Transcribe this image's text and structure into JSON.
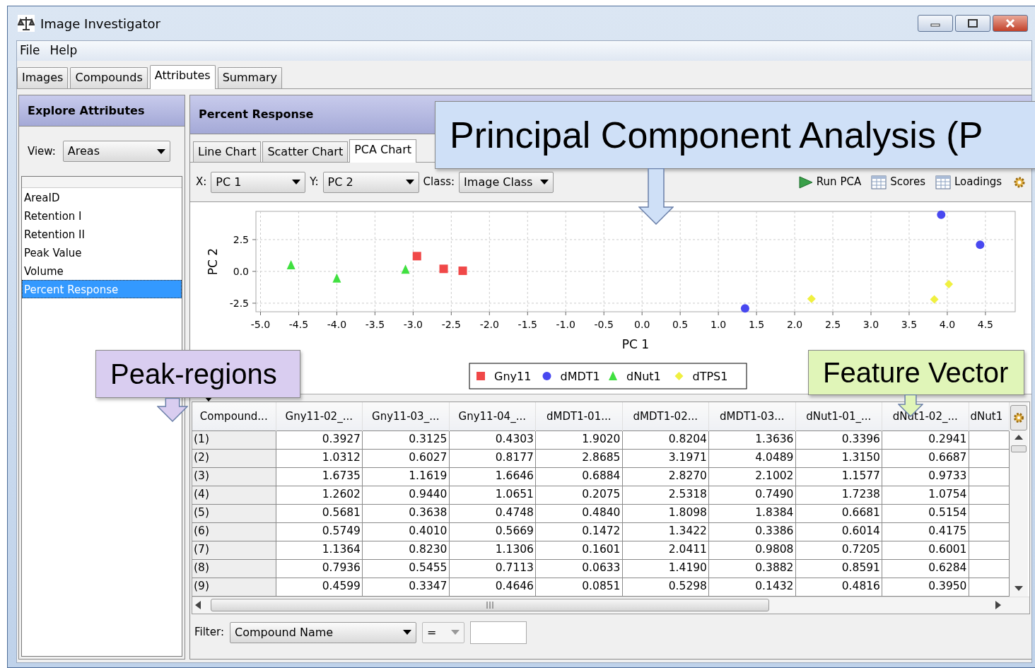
{
  "window": {
    "title": "Image Investigator"
  },
  "menu": [
    "File",
    "Help"
  ],
  "tabs": [
    {
      "label": "Images",
      "selected": false
    },
    {
      "label": "Compounds",
      "selected": false
    },
    {
      "label": "Attributes",
      "selected": true
    },
    {
      "label": "Summary",
      "selected": false
    }
  ],
  "sidebar": {
    "title": "Explore Attributes",
    "view_label": "View:",
    "view_value": "Areas",
    "items": [
      {
        "label": "AreaID",
        "selected": false
      },
      {
        "label": "Retention I",
        "selected": false
      },
      {
        "label": "Retention II",
        "selected": false
      },
      {
        "label": "Peak Value",
        "selected": false
      },
      {
        "label": "Volume",
        "selected": false
      },
      {
        "label": "Percent Response",
        "selected": true
      }
    ]
  },
  "panel": {
    "title": "Percent Response",
    "chart_tabs": [
      {
        "label": "Line Chart",
        "selected": false
      },
      {
        "label": "Scatter Chart",
        "selected": false
      },
      {
        "label": "PCA Chart",
        "selected": true
      }
    ],
    "toolbar": {
      "x_label": "X:",
      "x_value": "PC 1",
      "y_label": "Y:",
      "y_value": "PC 2",
      "class_label": "Class:",
      "class_value": "Image Class",
      "buttons": [
        {
          "label": "Run PCA",
          "kind": "run"
        },
        {
          "label": "Scores",
          "kind": "table"
        },
        {
          "label": "Loadings",
          "kind": "table"
        }
      ]
    },
    "chart_data": {
      "type": "scatter",
      "grid": true,
      "legend": "bottom",
      "xlabel": "PC 1",
      "ylabel": "PC 2",
      "xlim": [
        -5.06,
        4.89
      ],
      "ylim": [
        -3.17,
        4.72
      ],
      "xticks": [
        {
          "value": -5,
          "label": "-5.0"
        },
        {
          "value": -4.5,
          "label": "-4.5"
        },
        {
          "value": -4,
          "label": "-4.0"
        },
        {
          "value": -3.5,
          "label": "-3.5"
        },
        {
          "value": -3,
          "label": "-3.0"
        },
        {
          "value": -2.5,
          "label": "-2.5"
        },
        {
          "value": -2,
          "label": "-2.0"
        },
        {
          "value": -1.5,
          "label": "-1.5"
        },
        {
          "value": -1,
          "label": "-1.0"
        },
        {
          "value": -0.5,
          "label": "-0.5"
        },
        {
          "value": 0,
          "label": "0.0"
        },
        {
          "value": 0.5,
          "label": "0.5"
        },
        {
          "value": 1,
          "label": "1.0"
        },
        {
          "value": 1.5,
          "label": "1.5"
        },
        {
          "value": 2,
          "label": "2.0"
        },
        {
          "value": 2.5,
          "label": "2.5"
        },
        {
          "value": 3,
          "label": "3.0"
        },
        {
          "value": 3.5,
          "label": "3.5"
        },
        {
          "value": 4,
          "label": "4.0"
        },
        {
          "value": 4.5,
          "label": "4.5"
        }
      ],
      "yticks": [
        {
          "value": -2.5,
          "label": "-2.5"
        },
        {
          "value": 0,
          "label": "0.0"
        },
        {
          "value": 2.5,
          "label": "2.5"
        }
      ],
      "series": [
        {
          "name": "Gny11",
          "color": "#f04848",
          "x": [
            -2.95,
            -2.6,
            -2.35
          ],
          "values": [
            1.2,
            0.2,
            0.05
          ]
        },
        {
          "name": "dMDT1",
          "color": "#4848f0",
          "x": [
            3.92,
            4.43,
            1.35
          ],
          "values": [
            4.45,
            2.1,
            -2.9
          ]
        },
        {
          "name": "dNut1",
          "color": "#40e040",
          "x": [
            -4.6,
            -4.0,
            -3.1
          ],
          "values": [
            0.5,
            -0.55,
            0.15
          ]
        },
        {
          "name": "dTPS1",
          "color": "#f0f040",
          "x": [
            2.22,
            3.83,
            4.02
          ],
          "values": [
            -2.15,
            -2.2,
            -1.0
          ]
        }
      ]
    },
    "table": {
      "columns": [
        "Compound...",
        "Gny11-02_...",
        "Gny11-03_...",
        "Gny11-04_...",
        "dMDT1-01...",
        "dMDT1-02...",
        "dMDT1-03...",
        "dNut1-01_...",
        "dNut1-02_...",
        "dNut1"
      ],
      "rows": [
        [
          "(1)",
          "0.3927",
          "0.3125",
          "0.4303",
          "1.9020",
          "0.8204",
          "1.3636",
          "0.3396",
          "0.2941"
        ],
        [
          "(2)",
          "1.0312",
          "0.6027",
          "0.8177",
          "2.8685",
          "3.1971",
          "4.0489",
          "1.3150",
          "0.6687"
        ],
        [
          "(3)",
          "1.6735",
          "1.1619",
          "1.6646",
          "0.6884",
          "2.8270",
          "2.1002",
          "1.1577",
          "0.9733"
        ],
        [
          "(4)",
          "1.2602",
          "0.9440",
          "1.0651",
          "0.2075",
          "2.5318",
          "0.7490",
          "1.7238",
          "1.0754"
        ],
        [
          "(5)",
          "0.5681",
          "0.3638",
          "0.4748",
          "0.4840",
          "1.8098",
          "1.8384",
          "0.6681",
          "0.5154"
        ],
        [
          "(6)",
          "0.5749",
          "0.4010",
          "0.5669",
          "0.1472",
          "1.3422",
          "0.3386",
          "0.6014",
          "0.4175"
        ],
        [
          "(7)",
          "1.1364",
          "0.8230",
          "1.1306",
          "0.1601",
          "2.0411",
          "0.9808",
          "0.7205",
          "0.6001"
        ],
        [
          "(8)",
          "0.7936",
          "0.5455",
          "0.7113",
          "0.0633",
          "1.4190",
          "0.3882",
          "0.8591",
          "0.6284"
        ],
        [
          "(9)",
          "0.4599",
          "0.3347",
          "0.4646",
          "0.0851",
          "0.5298",
          "0.1432",
          "0.4816",
          "0.3950"
        ]
      ]
    },
    "filter": {
      "label": "Filter:",
      "field_value": "Compound Name",
      "operator": "="
    }
  },
  "callouts": [
    {
      "text": "Principal Component Analysis (P",
      "color": "#cfe0f7"
    },
    {
      "text": "Peak-regions",
      "color": "#d9cdf0"
    },
    {
      "text": "Feature Vector",
      "color": "#e0f5b8"
    }
  ]
}
